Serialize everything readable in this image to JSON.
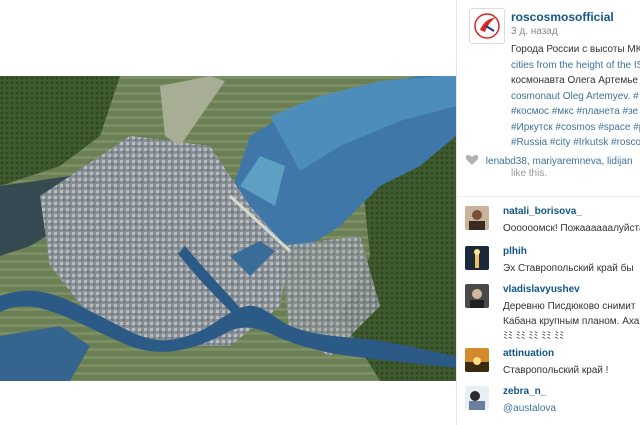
{
  "post": {
    "username": "roscosmosofficial",
    "time": "3 д. назад",
    "caption_lines": [
      "Города России с высоты МК",
      "cities from the height of the IS",
      "космонавта Олега Артемье",
      "cosmonaut Oleg Artemyev. #"
    ],
    "hashtag_lines": [
      "#космос #мкс #планета #зе",
      "#Иркутск #cosmos #space #p",
      "#Russia #city #Irkutsk #roscos"
    ]
  },
  "likes": {
    "names": "lenabd38, mariyaremneva, lidijan",
    "suffix": "like this."
  },
  "comments": [
    {
      "user": "natali_borisova_",
      "text": [
        "Оооооомск! Пожаааааалуйста"
      ]
    },
    {
      "user": "plhih",
      "text": [
        "Эх Ставропольский край бы"
      ]
    },
    {
      "user": "vladislavyushev",
      "text": [
        "Деревню Писдюково снимит",
        "Кабана крупным планом. Ахах",
        "ﾐﾐ ﾐﾐ ﾐﾐ ﾐﾐ ﾐﾐ"
      ]
    },
    {
      "user": "attinuation",
      "text": [
        "Ставропольский край !"
      ]
    },
    {
      "user": "zebra_n_",
      "text": [
        "@austalova"
      ]
    }
  ]
}
